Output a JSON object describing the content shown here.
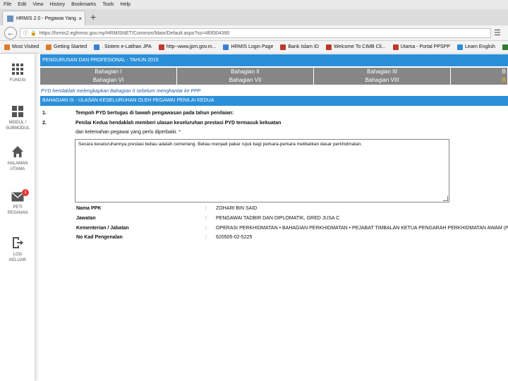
{
  "menubar": [
    "File",
    "Edit",
    "View",
    "History",
    "Bookmarks",
    "Tools",
    "Help"
  ],
  "tab": {
    "title": "HRMIS 2.0 - Pegawai Yang ...",
    "close": "×"
  },
  "new_tab": "+",
  "url": "https://hrmis2.eghrmis.gov.my/HRMISNET/Common/Main/Default.aspx?ss=4f0f304390",
  "bookmarks": [
    {
      "label": "Most Visited",
      "color": "#e07b2a"
    },
    {
      "label": "Getting Started",
      "color": "#e07b2a"
    },
    {
      "label": ". Sistem e-Latihan JPA",
      "color": "#3a7fd5"
    },
    {
      "label": "http--www.jpm.gov.m...",
      "color": "#c0392b"
    },
    {
      "label": "HRMIS Login Page",
      "color": "#3a7fd5"
    },
    {
      "label": "Bank Islam ID",
      "color": "#c0392b"
    },
    {
      "label": "Welcome To CIMB Cli...",
      "color": "#c0392b"
    },
    {
      "label": "Utama - Portal PPSPP",
      "color": "#c0392b"
    },
    {
      "label": "Learn English",
      "color": "#2a8fd9"
    },
    {
      "label": "English Grammar Onli...",
      "color": "#2e7d32"
    }
  ],
  "sidebar": [
    {
      "label": "FUNGSI",
      "icon": "grid-9-icon"
    },
    {
      "label": "MODUL /\nSUBMODUL",
      "icon": "grid-4-icon"
    },
    {
      "label": "HALAMAN\nUTAMA",
      "icon": "home-icon"
    },
    {
      "label": "PETI\nPESANAN",
      "icon": "mail-icon",
      "badge": "1"
    },
    {
      "label": "LOG\nKELUAR",
      "icon": "logout-icon"
    }
  ],
  "header": "PENGURUSAN DAN PROFESIONAL - TAHUN 2015",
  "table": {
    "columns": [
      "Bahagian I",
      "Bahagian II",
      "Bahagian III",
      "B"
    ],
    "row": [
      "Bahagian VI",
      "Bahagian VII",
      "Bahagian VIII",
      "B"
    ]
  },
  "note": "PYD hendaklah melengkapkan Bahagian II sebelum menghantar ke PPP",
  "bahagian_title": "BAHAGIAN IX - ULASAN KESELURUHAN OLEH PEGAWAI PENILAI KEDUA",
  "questions": [
    {
      "num": "1.",
      "text": "Tempoh PYD bertugas di bawah pengawasan pada tahun penilaian:"
    },
    {
      "num": "2.",
      "text": "Penilai Kedua hendaklah memberi ulasan keseluruhan prestasi PYD termasuk kekuatan"
    }
  ],
  "q2_cont": "dan kelemahan pegawai yang perlu diperbaiki. *",
  "comment": "Secara keseluruhannya prestasi beliau adalah cemerlang. Beliau menjadi pakar rujuk bagi perkara-perkara melibatkan dasar perkhidmatan.",
  "info": [
    {
      "label": "Nama PPK",
      "value": "ZOHARI BIN SAID"
    },
    {
      "label": "Jawatan",
      "value": "PENGAWAI TADBIR DAN DIPLOMATIK, GRED JUSA C"
    },
    {
      "label": "Kementerian / Jabatan",
      "value": "OPERASI PERKHIDMATAN • BAHAGIAN PERKHIDMATAN • PEJABAT TIMBALAN KETUA PENGARAH PERKHIDMATAN AWAM (PEMBANGUNAN)"
    },
    {
      "label": "No Kad Pengenalan",
      "value": "620505-02-5225"
    }
  ],
  "colon": ":",
  "colors": {
    "header_blue": "#2a8fd9",
    "table_grey": "#868686",
    "accent": "#1f5fa8"
  }
}
